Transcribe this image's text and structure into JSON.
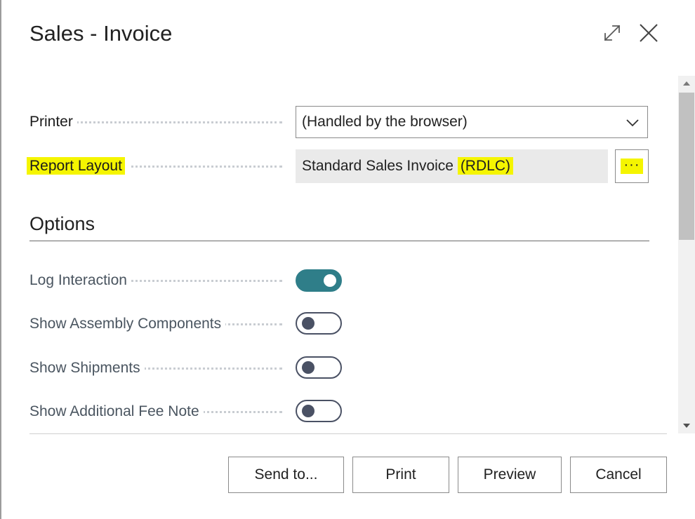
{
  "dialog": {
    "title": "Sales - Invoice"
  },
  "fields": {
    "printer": {
      "label": "Printer",
      "value": "(Handled by the browser)"
    },
    "report_layout": {
      "label": "Report Layout",
      "value_main": "Standard Sales Invoice ",
      "value_highlight": "(RDLC)",
      "lookup_label": "···"
    }
  },
  "options": {
    "title": "Options",
    "items": [
      {
        "label": "Log Interaction",
        "on": true
      },
      {
        "label": "Show Assembly Components",
        "on": false
      },
      {
        "label": "Show Shipments",
        "on": false
      },
      {
        "label": "Show Additional Fee Note",
        "on": false
      }
    ]
  },
  "footer": {
    "send_to": "Send to...",
    "print": "Print",
    "preview": "Preview",
    "cancel": "Cancel"
  },
  "colors": {
    "highlight": "#f5f500",
    "toggle_on": "#2f7e89",
    "toggle_off": "#4a5164"
  },
  "icons": {
    "expand": "expand-icon",
    "close": "close-icon",
    "dropdown": "chevron-down-icon",
    "scroll_up": "triangle-up-icon",
    "scroll_down": "triangle-down-icon"
  }
}
